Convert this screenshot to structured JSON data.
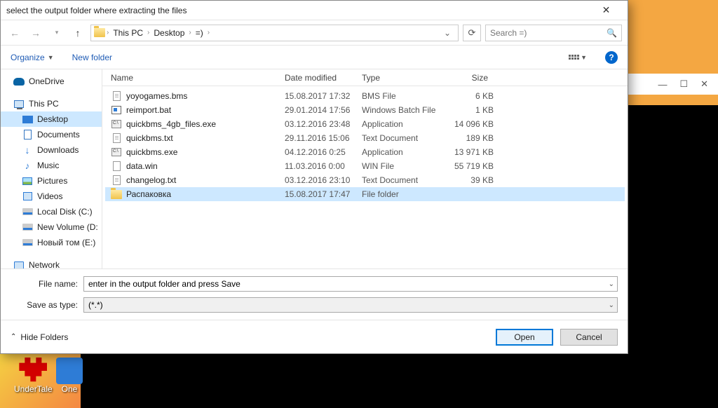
{
  "title": "select the output folder where extracting the files",
  "breadcrumb": [
    "This PC",
    "Desktop",
    "=)"
  ],
  "search_placeholder": "Search =)",
  "toolbar": {
    "organize": "Organize",
    "new_folder": "New folder"
  },
  "sidebar": {
    "onedrive": "OneDrive",
    "this_pc": "This PC",
    "items": [
      "Desktop",
      "Documents",
      "Downloads",
      "Music",
      "Pictures",
      "Videos",
      "Local Disk (C:)",
      "New Volume (D:",
      "Новый том (E:)"
    ],
    "network": "Network"
  },
  "columns": {
    "name": "Name",
    "date": "Date modified",
    "type": "Type",
    "size": "Size"
  },
  "files": [
    {
      "icon": "doc",
      "name": "yoyogames.bms",
      "date": "15.08.2017 17:32",
      "type": "BMS File",
      "size": "6 KB"
    },
    {
      "icon": "bat",
      "name": "reimport.bat",
      "date": "29.01.2014 17:56",
      "type": "Windows Batch File",
      "size": "1 KB"
    },
    {
      "icon": "exe",
      "name": "quickbms_4gb_files.exe",
      "date": "03.12.2016 23:48",
      "type": "Application",
      "size": "14 096 KB"
    },
    {
      "icon": "doc",
      "name": "quickbms.txt",
      "date": "29.11.2016 15:06",
      "type": "Text Document",
      "size": "189 KB"
    },
    {
      "icon": "exe",
      "name": "quickbms.exe",
      "date": "04.12.2016 0:25",
      "type": "Application",
      "size": "13 971 KB"
    },
    {
      "icon": "win",
      "name": "data.win",
      "date": "11.03.2016 0:00",
      "type": "WIN File",
      "size": "55 719 KB"
    },
    {
      "icon": "doc",
      "name": "changelog.txt",
      "date": "03.12.2016 23:10",
      "type": "Text Document",
      "size": "39 KB"
    },
    {
      "icon": "folder",
      "name": "Распаковка",
      "date": "15.08.2017 17:47",
      "type": "File folder",
      "size": "",
      "selected": true
    }
  ],
  "filename_label": "File name:",
  "filename_value": "enter in the output folder and press Save",
  "savetype_label": "Save as type:",
  "savetype_value": "(*.*)",
  "hide_folders": "Hide Folders",
  "open_btn": "Open",
  "cancel_btn": "Cancel",
  "desktop_icons": [
    "UnderTale",
    "One"
  ],
  "bg_window": {
    "min": "—",
    "max": "☐",
    "close": "✕"
  }
}
